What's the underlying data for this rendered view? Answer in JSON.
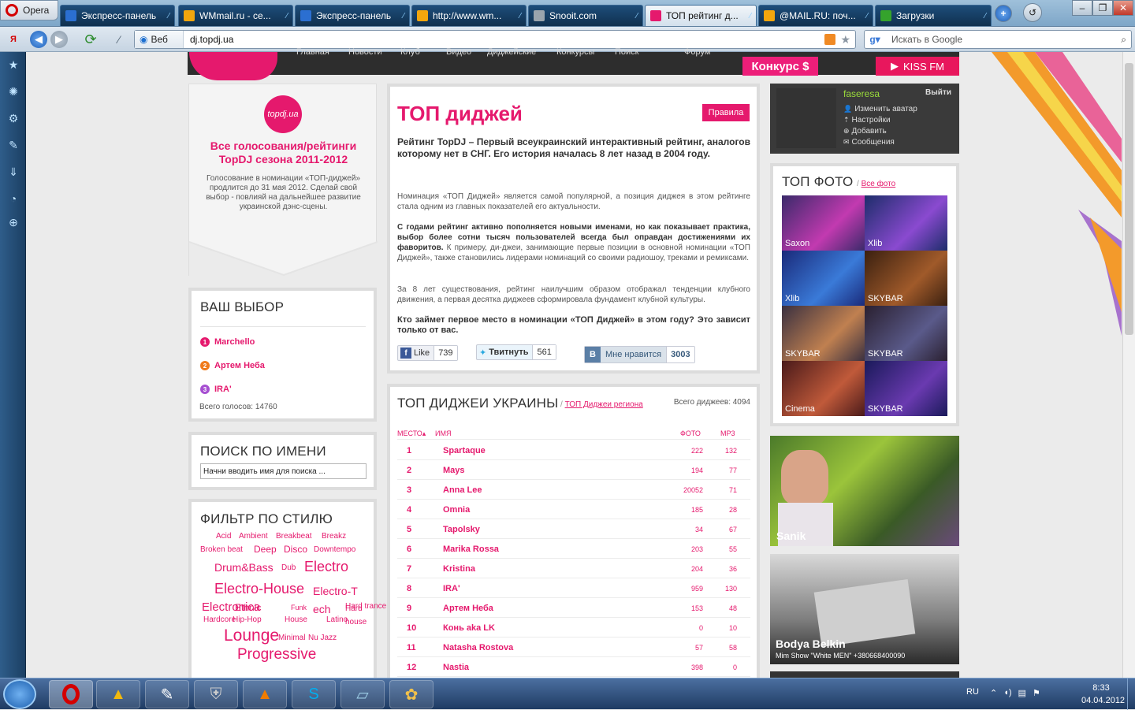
{
  "browser": {
    "menu_label": "Opera",
    "tabs": [
      {
        "title": "Экспресс-панель",
        "favicon": "#2b6fd1"
      },
      {
        "title": "WMmail.ru - се...",
        "favicon": "#f2a60d"
      },
      {
        "title": "Экспресс-панель",
        "favicon": "#2b6fd1"
      },
      {
        "title": "http://www.wm...",
        "favicon": "#f2a60d"
      },
      {
        "title": "Snooit.com",
        "favicon": "#9aa4ad"
      },
      {
        "title": "ТОП рейтинг д...",
        "favicon": "#e5196d"
      },
      {
        "title": "@MAIL.RU: поч...",
        "favicon": "#f2a60d"
      },
      {
        "title": "Загрузки",
        "favicon": "#35a32c"
      }
    ],
    "address_mode": "Веб",
    "url": "dj.topdj.ua",
    "search_placeholder": "Искать в Google"
  },
  "site": {
    "nav_items": [
      "Главная",
      "Новости",
      "Клуб",
      "Видео",
      "Диджейские",
      "Конкурсы",
      "Поиск",
      "Форум"
    ],
    "konkurs_label": "Конкурс $",
    "kissfm_label": "KISS FM",
    "user": {
      "name": "faseresa",
      "logout": "Выйти",
      "links": [
        "Изменить аватар",
        "Настройки",
        "Добавить",
        "Сообщения"
      ]
    },
    "promo": {
      "logo_text": "topdj.ua",
      "title": "Все голосования/рейтинги TopDJ сезона 2011-2012",
      "text": "Голосование в номинации «ТОП-диджей» продлится до 31 мая 2012. Сделай свой выбор - повлияй на дальнейшее развитие украинской дэнс-сцены."
    },
    "your_choice": {
      "title": "ВАШ ВЫБОР",
      "items": [
        {
          "n": "1",
          "name": "Marchello",
          "color": "#e5196d"
        },
        {
          "n": "2",
          "name": "Артем Неба",
          "color": "#f07b1d"
        },
        {
          "n": "3",
          "name": "IRA'",
          "color": "#a64fd1"
        }
      ],
      "total": "Всего голосов: 14760"
    },
    "search": {
      "title": "ПОИСК ПО ИМЕНИ",
      "placeholder": "Начни вводить имя для поиска ..."
    },
    "filter": {
      "title": "ФИЛЬТР ПО СТИЛЮ",
      "tags": [
        "Acid",
        "Ambient",
        "Breakbeat",
        "Breakz",
        "Broken beat",
        "Deep",
        "Disco",
        "Downtempo",
        "Drum&Bass",
        "Dub",
        "Electro",
        "Electro-House",
        "Electro-Tech",
        "Electronica",
        "Ethnic",
        "Funk",
        "Hard house",
        "Hard trance",
        "Hardcore",
        "Hip-Hop",
        "House",
        "Latino",
        "Lounge",
        "Minimal",
        "Nu Jazz",
        "Progressive"
      ]
    },
    "main": {
      "title": "ТОП диджей",
      "rules_label": "Правила",
      "lead": "Рейтинг TopDJ – Первый всеукраинский интерактивный рейтинг, аналогов которому нет в СНГ. Его история началась 8 лет назад в 2004 году.",
      "p1": "Номинация «ТОП Диджей» является самой популярной, а позиция диджея в этом рейтинге стала одним из главных показателей его актуальности.",
      "p2_bold": "С годами рейтинг активно пополняется новыми именами, но как показывает практика, выбор более сотни тысяч пользователей всегда был оправдан достижениями их фаворитов.",
      "p2_rest": " К примеру, ди-джеи, занимающие первые позиции в основной номинации «ТОП Диджей», также становились лидерами номинаций со своими радиошоу, треками и ремиксами.",
      "p3": "За 8 лет существования, рейтинг наилучшим образом отображал тенденции клубного движения, а первая десятка диджеев сформировала фундамент клубной культуры.",
      "p4": "Кто займет первое место в номинации «ТОП Диджей» в этом году? Это зависит только от вас.",
      "like_label": "Like",
      "like_count": "739",
      "tweet_label": "Твитнуть",
      "tweet_count": "561",
      "vk_label": "Мне нравится",
      "vk_count": "3003"
    },
    "ranking": {
      "title": "ТОП ДИДЖЕИ УКРАИНЫ",
      "region_link": "ТОП Диджеи региона",
      "total": "Всего диджеев: 4094",
      "headers": {
        "place": "МЕСТО",
        "name": "ИМЯ",
        "photo": "ФОТО",
        "mp3": "MP3"
      },
      "rows": [
        {
          "rank": "1",
          "name": "Spartaque",
          "photo": "222",
          "mp3": "132"
        },
        {
          "rank": "2",
          "name": "Mays",
          "photo": "194",
          "mp3": "77"
        },
        {
          "rank": "3",
          "name": "Anna Lee",
          "photo": "20052",
          "mp3": "71"
        },
        {
          "rank": "4",
          "name": "Omnia",
          "photo": "185",
          "mp3": "28"
        },
        {
          "rank": "5",
          "name": "Tapolsky",
          "photo": "34",
          "mp3": "67"
        },
        {
          "rank": "6",
          "name": "Marika Rossa",
          "photo": "203",
          "mp3": "55"
        },
        {
          "rank": "7",
          "name": "Kristina",
          "photo": "204",
          "mp3": "36"
        },
        {
          "rank": "8",
          "name": "IRA'",
          "photo": "959",
          "mp3": "130"
        },
        {
          "rank": "9",
          "name": "Артем Неба",
          "photo": "153",
          "mp3": "48"
        },
        {
          "rank": "10",
          "name": "Конь aka LK",
          "photo": "0",
          "mp3": "10"
        },
        {
          "rank": "11",
          "name": "Natasha Rostova",
          "photo": "57",
          "mp3": "58"
        },
        {
          "rank": "12",
          "name": "Nastia",
          "photo": "398",
          "mp3": "0"
        }
      ]
    },
    "top_photo": {
      "title": "ТОП ФОТО",
      "all_link": "Все фото",
      "tiles": [
        {
          "label": "Saxon",
          "c1": "#3a2a6a",
          "c2": "#c23ab0"
        },
        {
          "label": "Xlib",
          "c1": "#1d2d6a",
          "c2": "#8a4ad0"
        },
        {
          "label": "Xlib",
          "c1": "#1a2a7a",
          "c2": "#3a7ad8"
        },
        {
          "label": "SKYBAR",
          "c1": "#3a2010",
          "c2": "#a05a2a"
        },
        {
          "label": "SKYBAR",
          "c1": "#3a3040",
          "c2": "#c08050"
        },
        {
          "label": "SKYBAR",
          "c1": "#2a2030",
          "c2": "#5a5a8a"
        },
        {
          "label": "Cinema",
          "c1": "#4a1a1a",
          "c2": "#c05a3a"
        },
        {
          "label": "SKYBAR",
          "c1": "#1a1a5a",
          "c2": "#6a3ab0"
        }
      ]
    },
    "feature1": {
      "name": "Sanik"
    },
    "feature2": {
      "name": "Bodya Belkin",
      "subtitle": "Mim Show \"White MEN\" +380668400090"
    }
  },
  "taskbar": {
    "lang": "RU",
    "time": "8:33",
    "date": "04.04.2012"
  }
}
